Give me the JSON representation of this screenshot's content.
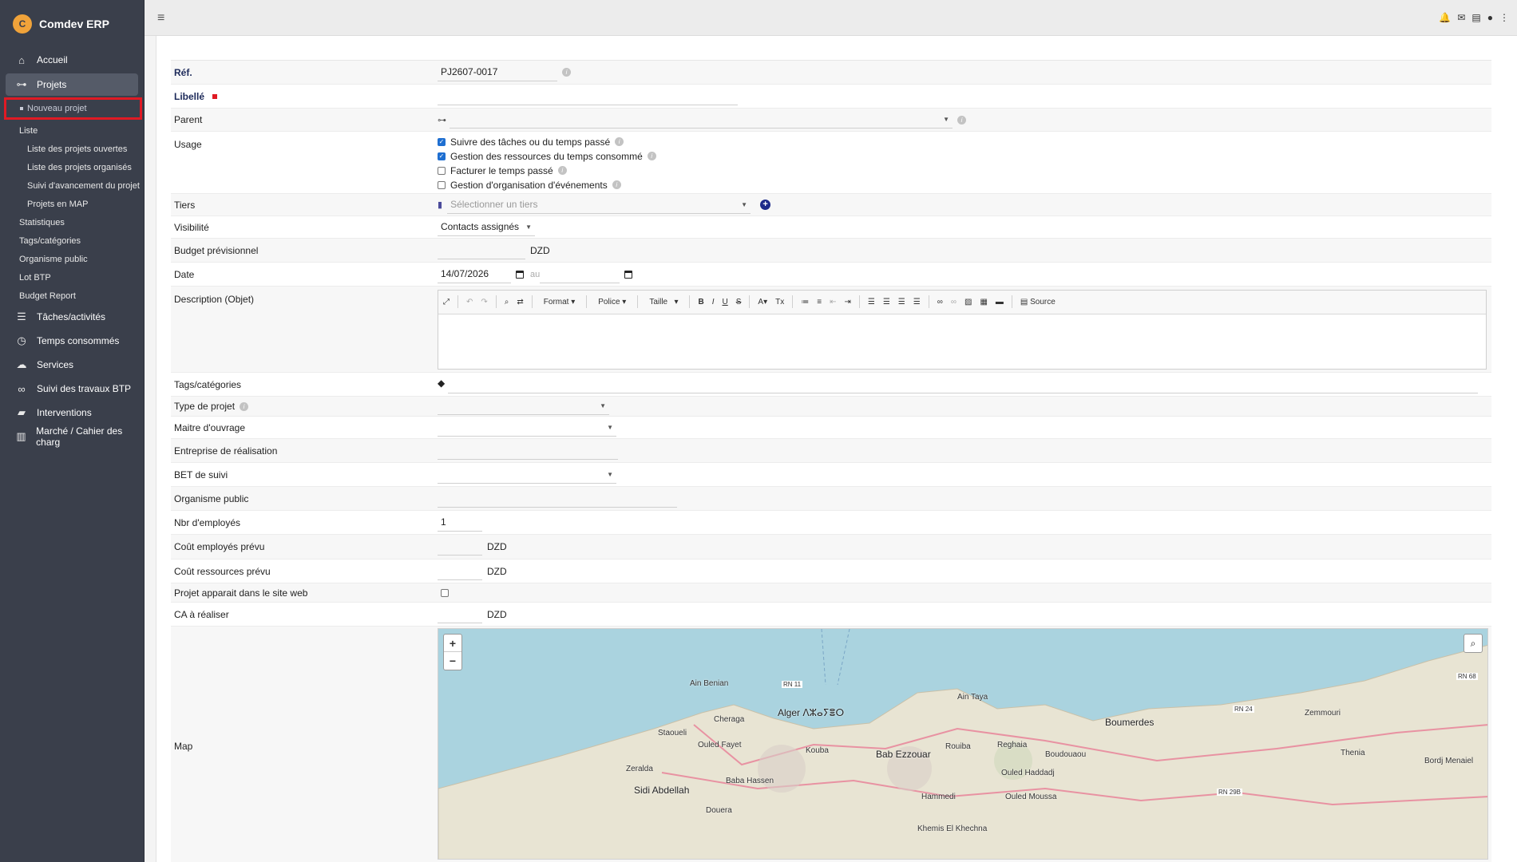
{
  "app": {
    "name": "Comdev ERP",
    "logo_text": "C"
  },
  "sidebar": {
    "items": [
      {
        "label": "Accueil",
        "icon": "home-icon"
      },
      {
        "label": "Projets",
        "icon": "sitemap-icon"
      }
    ],
    "projets_sub": [
      {
        "label": "Nouveau projet"
      },
      {
        "label": "Liste"
      },
      {
        "label": "Liste des projets ouvertes"
      },
      {
        "label": "Liste des projets organisés"
      },
      {
        "label": "Suivi d'avancement du projet"
      },
      {
        "label": "Projets en MAP"
      },
      {
        "label": "Statistiques"
      },
      {
        "label": "Tags/catégories"
      },
      {
        "label": "Organisme public"
      },
      {
        "label": "Lot BTP"
      },
      {
        "label": "Budget Report"
      }
    ],
    "more_items": [
      {
        "label": "Tâches/activités",
        "icon": "tasks-icon"
      },
      {
        "label": "Temps consommés",
        "icon": "clock-icon"
      },
      {
        "label": "Services",
        "icon": "cloud-icon"
      },
      {
        "label": "Suivi des travaux BTP",
        "icon": "binoculars-icon"
      },
      {
        "label": "Interventions",
        "icon": "truck-icon"
      },
      {
        "label": "Marché / Cahier des charg",
        "icon": "book-icon"
      }
    ]
  },
  "form": {
    "ref_label": "Réf.",
    "ref_value": "PJ2607-0017",
    "libelle_label": "Libellé",
    "parent_label": "Parent",
    "usage_label": "Usage",
    "usage_options": [
      {
        "label": "Suivre des tâches ou du temps passé",
        "checked": true
      },
      {
        "label": "Gestion des ressources du temps consommé",
        "checked": true
      },
      {
        "label": "Facturer le temps passé",
        "checked": false
      },
      {
        "label": "Gestion d'organisation d'événements",
        "checked": false
      }
    ],
    "tiers_label": "Tiers",
    "tiers_placeholder": "Sélectionner un tiers",
    "visibilite_label": "Visibilité",
    "visibilite_value": "Contacts assignés",
    "budget_label": "Budget prévisionnel",
    "currency": "DZD",
    "date_label": "Date",
    "date_start": "14/07/2026",
    "date_to": "au",
    "description_label": "Description (Objet)",
    "editor": {
      "format": "Format",
      "police": "Police",
      "taille": "Taille",
      "source": "Source"
    },
    "tags_label": "Tags/catégories",
    "type_label": "Type de projet",
    "maitre_label": "Maitre d'ouvrage",
    "entreprise_label": "Entreprise de réalisation",
    "bet_label": "BET de suivi",
    "organisme_label": "Organisme public",
    "nbr_label": "Nbr d'employés",
    "nbr_value": "1",
    "cout_emp_label": "Coût employés prévu",
    "cout_res_label": "Coût ressources prévu",
    "web_label": "Projet apparait dans le site web",
    "ca_label": "CA à réaliser",
    "map_label": "Map"
  },
  "map": {
    "zoom_in": "+",
    "zoom_out": "−",
    "places": [
      "Alger ⴷⵣⴰⵢⴻⵔ",
      "Bab Ezzouar",
      "Boumerdes",
      "Ain Benian",
      "Cheraga",
      "Staoueli",
      "Ouled Fayet",
      "Zeralda",
      "Sidi Abdellah",
      "Baba Hassen",
      "Kouba",
      "Ain Taya",
      "Rouiba",
      "Reghaia",
      "Boudouaou",
      "Hammedi",
      "Ouled Moussa",
      "Thenia",
      "Zemmouri",
      "Bordj Menaiel",
      "Ouled Haddadj",
      "Douera",
      "Khemis El Khechna"
    ],
    "roads": [
      "RN 11",
      "RN 24",
      "RN 68",
      "RN 29B"
    ],
    "water_color": "#aad3df",
    "land_color": "#f2efe9"
  },
  "colors": {
    "sidebar": "#3a3f4b",
    "highlight": "#e01a24",
    "accent": "#1d2a5a"
  }
}
